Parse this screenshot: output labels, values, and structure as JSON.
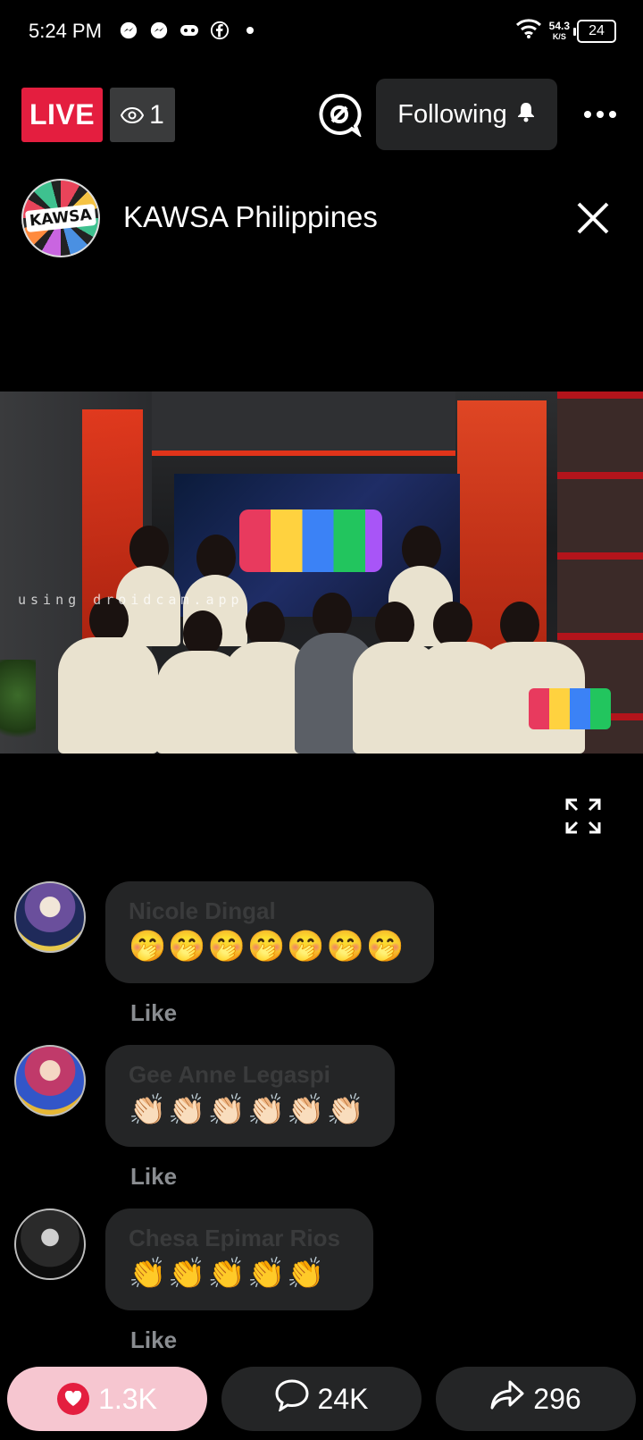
{
  "status_bar": {
    "time": "5:24 PM",
    "notification_icons": [
      "messenger-icon",
      "messenger-icon",
      "game-controller-icon",
      "facebook-icon",
      "dot-icon"
    ],
    "network_speed": "54.3",
    "network_speed_unit": "K/S",
    "battery": "24"
  },
  "live_header": {
    "live_label": "LIVE",
    "viewer_count": "1",
    "follow_label": "Following",
    "page_name": "KAWSA Philippines",
    "page_avatar_text": "KAWSA"
  },
  "video": {
    "watermark": "using droidcam.app"
  },
  "comments": [
    {
      "name": "Nicole Dingal",
      "text": "🤭🤭🤭🤭🤭🤭🤭",
      "like_label": "Like"
    },
    {
      "name": "Gee Anne Legaspi",
      "text": "👏🏻👏🏻👏🏻👏🏻👏🏻👏🏻",
      "like_label": "Like"
    },
    {
      "name": "Chesa Epimar Rios",
      "text": "👏👏👏👏👏",
      "like_label": "Like"
    }
  ],
  "actions": {
    "reactions_count": "1.3K",
    "comments_count": "24K",
    "shares_count": "296"
  },
  "colors": {
    "live_red": "#e41e3f",
    "surface": "#242526",
    "like_pill": "#f6c6d0"
  }
}
